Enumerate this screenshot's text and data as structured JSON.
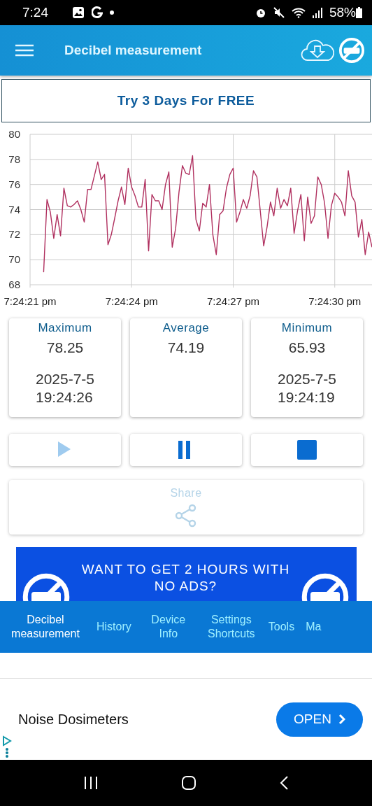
{
  "status_bar": {
    "time": "7:24",
    "battery": "58%"
  },
  "app_bar": {
    "title": "Decibel measurement"
  },
  "trial_button": "Try 3 Days For FREE",
  "chart": {
    "chart_data": {
      "type": "line",
      "grid": true,
      "ylim": [
        68,
        80
      ],
      "yticks": [
        68,
        70,
        72,
        74,
        76,
        78,
        80
      ],
      "categories": [
        "7:24:21 pm",
        null,
        null,
        null,
        null,
        null,
        null,
        null,
        null,
        null,
        null,
        null,
        null,
        null,
        null,
        null,
        null,
        null,
        null,
        null,
        null,
        null,
        null,
        null,
        null,
        null,
        null,
        null,
        null,
        null,
        "7:24:24 pm",
        null,
        null,
        null,
        null,
        null,
        null,
        null,
        null,
        null,
        null,
        null,
        null,
        null,
        null,
        null,
        null,
        null,
        null,
        null,
        null,
        null,
        null,
        null,
        null,
        null,
        null,
        null,
        null,
        null,
        "7:24:27 pm",
        null,
        null,
        null,
        null,
        null,
        null,
        null,
        null,
        null,
        null,
        null,
        null,
        null,
        null,
        null,
        null,
        null,
        null,
        null,
        null,
        null,
        null,
        null,
        null,
        null,
        null,
        null,
        null,
        null,
        "7:24:30 pm",
        null,
        null,
        null,
        null,
        null,
        null,
        null,
        null,
        null,
        null,
        null
      ],
      "series": [
        {
          "color": "#b0305f",
          "values": [
            null,
            null,
            null,
            null,
            69,
            74.8,
            73.8,
            71.7,
            73.6,
            71.9,
            75.7,
            74.3,
            74.2,
            74.4,
            74.7,
            74.0,
            73.0,
            75.6,
            75.6,
            76.7,
            77.8,
            76.4,
            76.8,
            71.2,
            72.0,
            73.3,
            74.7,
            75.8,
            74.4,
            77.3,
            75.8,
            75.1,
            74.2,
            74.2,
            76.4,
            70.7,
            75.2,
            74.7,
            74.7,
            74.0,
            76.0,
            77.0,
            71.0,
            72.5,
            75.4,
            77.5,
            76.9,
            76.8,
            78.3,
            73.2,
            72.3,
            74.5,
            74.2,
            76.0,
            72.0,
            70.4,
            73.6,
            73.9,
            75.7,
            76.8,
            77.3,
            73.0,
            73.8,
            74.8,
            74.1,
            75.1,
            77.1,
            76.6,
            73.9,
            71.1,
            72.6,
            74.6,
            73.5,
            75.7,
            74.1,
            74.8,
            74.3,
            75.7,
            72.1,
            73.9,
            75.2,
            71.5,
            75.0,
            72.9,
            73.5,
            76.6,
            76.0,
            74.5,
            71.7,
            74.3,
            75.3,
            75.0,
            74.6,
            73.5,
            77.1,
            75.1,
            74.6,
            71.8,
            73.2,
            70.4,
            72.2,
            71.0
          ]
        }
      ]
    }
  },
  "stats": [
    {
      "label": "Maximum",
      "value": "78.25",
      "date": "2025-7-5",
      "time": "19:24:26"
    },
    {
      "label": "Average",
      "value": "74.19"
    },
    {
      "label": "Minimum",
      "value": "65.93",
      "date": "2025-7-5",
      "time": "19:24:19"
    }
  ],
  "controls": [
    {
      "kind": "play",
      "disabled": true
    },
    {
      "kind": "pause",
      "disabled": false
    },
    {
      "kind": "stop",
      "disabled": false
    }
  ],
  "share": {
    "label": "Share",
    "disabled": true
  },
  "promo_banner": {
    "lines": [
      "WANT TO GET 2 HOURS WITH",
      "NO ADS?"
    ]
  },
  "bottom_tabs": [
    {
      "label": "Decibel measurement",
      "selected": true
    },
    {
      "label": "History",
      "selected": false
    },
    {
      "label": "Device Info",
      "selected": false
    },
    {
      "label": "Settings Shortcuts",
      "selected": false
    },
    {
      "label": "Tools",
      "selected": false
    },
    {
      "label": "Ma",
      "selected": false
    }
  ],
  "ad": {
    "title": "Noise Dosimeters",
    "button": "OPEN"
  }
}
